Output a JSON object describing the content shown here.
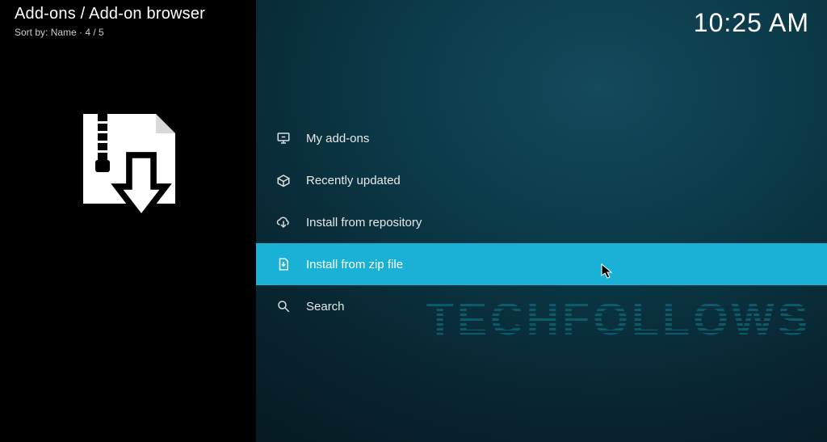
{
  "header": {
    "breadcrumb": "Add-ons / Add-on browser",
    "sort_prefix": "Sort by: ",
    "sort_field": "Name",
    "separator": "  ·  ",
    "position": "4 / 5"
  },
  "clock": "10:25 AM",
  "menu": {
    "items": [
      {
        "key": "my-addons",
        "label": "My add-ons",
        "icon": "screen-icon"
      },
      {
        "key": "recently-updated",
        "label": "Recently updated",
        "icon": "open-box-icon"
      },
      {
        "key": "install-from-repository",
        "label": "Install from repository",
        "icon": "cloud-download-icon"
      },
      {
        "key": "install-from-zip-file",
        "label": "Install from zip file",
        "icon": "zip-file-icon"
      },
      {
        "key": "search",
        "label": "Search",
        "icon": "search-icon"
      }
    ],
    "selected_index": 3
  },
  "watermark": "TECHFOLLOWS"
}
